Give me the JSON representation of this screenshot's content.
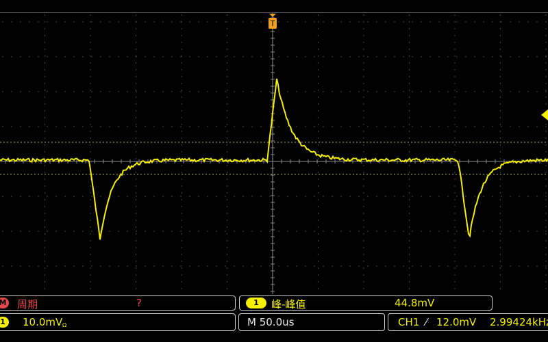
{
  "measurement_left": {
    "badge": "M",
    "label": "周期",
    "value": "?"
  },
  "measurement_mid": {
    "badge": "1",
    "label": "峰-峰值",
    "value": "44.8mV"
  },
  "status": {
    "channel_badge": "1",
    "channel_scale": "10.0mV",
    "bw_symbol": "Ω",
    "timebase": "M 50.0us",
    "trigger_channel": "CH1",
    "trigger_slope": "⁄",
    "trigger_level": "12.0mV",
    "frequency": "2.99424kHz"
  },
  "colors": {
    "trace": "#f5f000",
    "trigger_marker": "#f0a020",
    "math": "#e8484a",
    "grid": "#7a7a7a"
  },
  "icons": {
    "trigger_position": "trigger-position-marker-icon",
    "trigger_level": "trigger-level-arrow-icon"
  }
}
